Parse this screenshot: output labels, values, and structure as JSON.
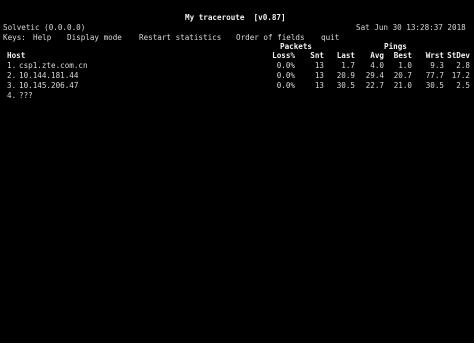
{
  "title": "My traceroute  [v0.87]",
  "hostname": "Solvetic (0.0.0.0)",
  "datetime": "Sat Jun 30 13:28:37 2018",
  "keys": {
    "label": "Keys:",
    "items": [
      "Help",
      "Display mode",
      "Restart statistics",
      "Order of fields",
      "quit"
    ]
  },
  "headers": {
    "group_packets": "Packets",
    "group_pings": "Pings",
    "host": "Host",
    "columns": [
      "Loss%",
      "Snt",
      "Last",
      "Avg",
      "Best",
      "Wrst",
      "StDev"
    ]
  },
  "hops": [
    {
      "num": "1.",
      "host": "csp1.zte.com.cn",
      "loss": "0.0%",
      "snt": "13",
      "last": "1.7",
      "avg": "4.0",
      "best": "1.0",
      "wrst": "9.3",
      "stdev": "2.8"
    },
    {
      "num": "2.",
      "host": "10.144.181.44",
      "loss": "0.0%",
      "snt": "13",
      "last": "20.9",
      "avg": "29.4",
      "best": "20.7",
      "wrst": "77.7",
      "stdev": "17.2"
    },
    {
      "num": "3.",
      "host": "10.145.206.47",
      "loss": "0.0%",
      "snt": "13",
      "last": "30.5",
      "avg": "22.7",
      "best": "21.0",
      "wrst": "30.5",
      "stdev": "2.5"
    },
    {
      "num": "4.",
      "host": "???"
    }
  ]
}
